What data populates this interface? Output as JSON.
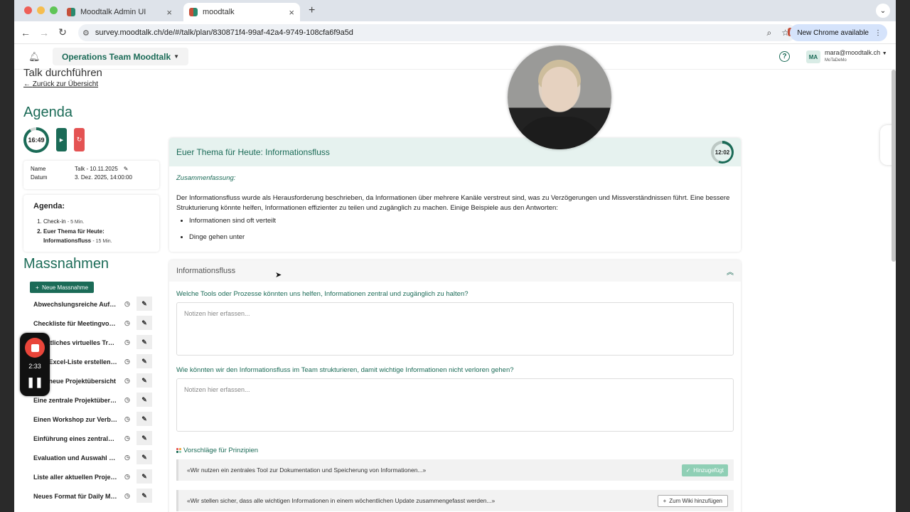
{
  "browser": {
    "tabs": [
      {
        "title": "Moodtalk Admin UI",
        "active": false
      },
      {
        "title": "moodtalk",
        "active": true
      }
    ],
    "url": "survey.moodtalk.ch/de/#/talk/plan/830871f4-99af-42a4-9749-108cfa6f9a5d",
    "update_label": "New Chrome available"
  },
  "header": {
    "team_label": "Operations Team Moodtalk",
    "help_label": "?",
    "user_initials": "MA",
    "user_email": "mara@moodtalk.ch",
    "user_org": "MoTaDeMo"
  },
  "page": {
    "title": "Talk durchführen",
    "back_link": "Zurück zur Übersicht"
  },
  "agenda": {
    "heading": "Agenda",
    "timer": "16:49",
    "meta": {
      "name_label": "Name",
      "name_value": "Talk - 10.11.2025",
      "date_label": "Datum",
      "date_value": "3. Dez. 2025, 14:00:00"
    },
    "card_title": "Agenda:",
    "items": [
      {
        "label": "Check-in",
        "duration": "5 Min."
      },
      {
        "label": "Euer Thema für Heute: Informationsfluss",
        "duration": "15 Min."
      }
    ]
  },
  "massnahmen": {
    "heading": "Massnahmen",
    "new_button": "Neue Massnahme",
    "items": [
      "Abwechslungsreiche Aufgaben",
      "Checkliste für Meetingvorbereitung",
      "Monatliches virtuelles Treffen",
      "Eine Excel-Liste erstellen, um",
      "Eine neue Projektübersicht",
      "Eine zentrale Projektübersicht",
      "Einen Workshop zur Verbesserung",
      "Einführung eines zentralen Tools",
      "Evaluation und Auswahl eines Tools",
      "Liste aller aktuellen Projekte",
      "Neues Format für Daily Meetings"
    ]
  },
  "theme": {
    "title": "Euer Thema für Heute: Informationsfluss",
    "timer": "12:02",
    "summary_label": "Zusammenfassung:",
    "summary_text": "Der Informationsfluss wurde als Herausforderung beschrieben, da Informationen über mehrere Kanäle verstreut sind, was zu Verzögerungen und Missverständnissen führt. Eine bessere Strukturierung könnte helfen, Informationen effizienter zu teilen und zugänglich zu machen. Einige Beispiele aus den Antworten:",
    "examples": [
      "Informationen sind oft verteilt",
      "Dinge gehen unter"
    ]
  },
  "section": {
    "title": "Informationsfluss",
    "question1": "Welche Tools oder Prozesse könnten uns helfen, Informationen zentral und zugänglich zu halten?",
    "question2": "Wie könnten wir den Informationsfluss im Team strukturieren, damit wichtige Informationen nicht verloren gehen?",
    "notes_placeholder": "Notizen hier erfassen...",
    "suggestions_title": "Vorschläge für Prinzipien",
    "suggestions": [
      {
        "text": "«Wir nutzen ein zentrales Tool zur Dokumentation und Speicherung von Informationen...»",
        "action": "Hinzugefügt"
      },
      {
        "text": "«Wir stellen sicher, dass alle wichtigen Informationen in einem wöchentlichen Update zusammengefasst werden...»",
        "action": "Zum Wiki hinzufügen"
      }
    ]
  },
  "recorder": {
    "time": "2:33"
  },
  "colors": {
    "brand": "#1b6b57",
    "danger": "#e45353",
    "added": "#8fcfb5"
  }
}
